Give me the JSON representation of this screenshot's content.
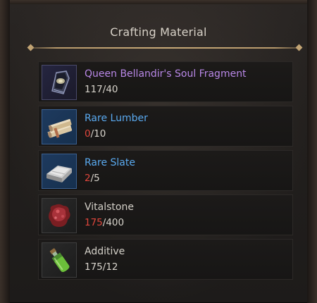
{
  "panel": {
    "title": "Crafting Material"
  },
  "colors": {
    "epic_name": "#b887e6",
    "rare_name": "#5aaaf0",
    "common_name": "#d4d0c8",
    "insufficient": "#e0463c",
    "sufficient": "#d8d4cc",
    "divider": "#c2a474"
  },
  "materials": [
    {
      "name": "Queen Bellandir's Soul Fragment",
      "have": "117",
      "need": "40",
      "rarity": "epic",
      "sufficient": true,
      "icon": "soul-fragment-icon"
    },
    {
      "name": "Rare Lumber",
      "have": "0",
      "need": "10",
      "rarity": "rare",
      "sufficient": false,
      "icon": "lumber-icon"
    },
    {
      "name": "Rare Slate",
      "have": "2",
      "need": "5",
      "rarity": "rare",
      "sufficient": false,
      "icon": "slate-icon"
    },
    {
      "name": "Vitalstone",
      "have": "175",
      "need": "400",
      "rarity": "common",
      "sufficient": false,
      "icon": "vitalstone-icon"
    },
    {
      "name": "Additive",
      "have": "175",
      "need": "12",
      "rarity": "common",
      "sufficient": true,
      "icon": "additive-potion-icon"
    }
  ]
}
